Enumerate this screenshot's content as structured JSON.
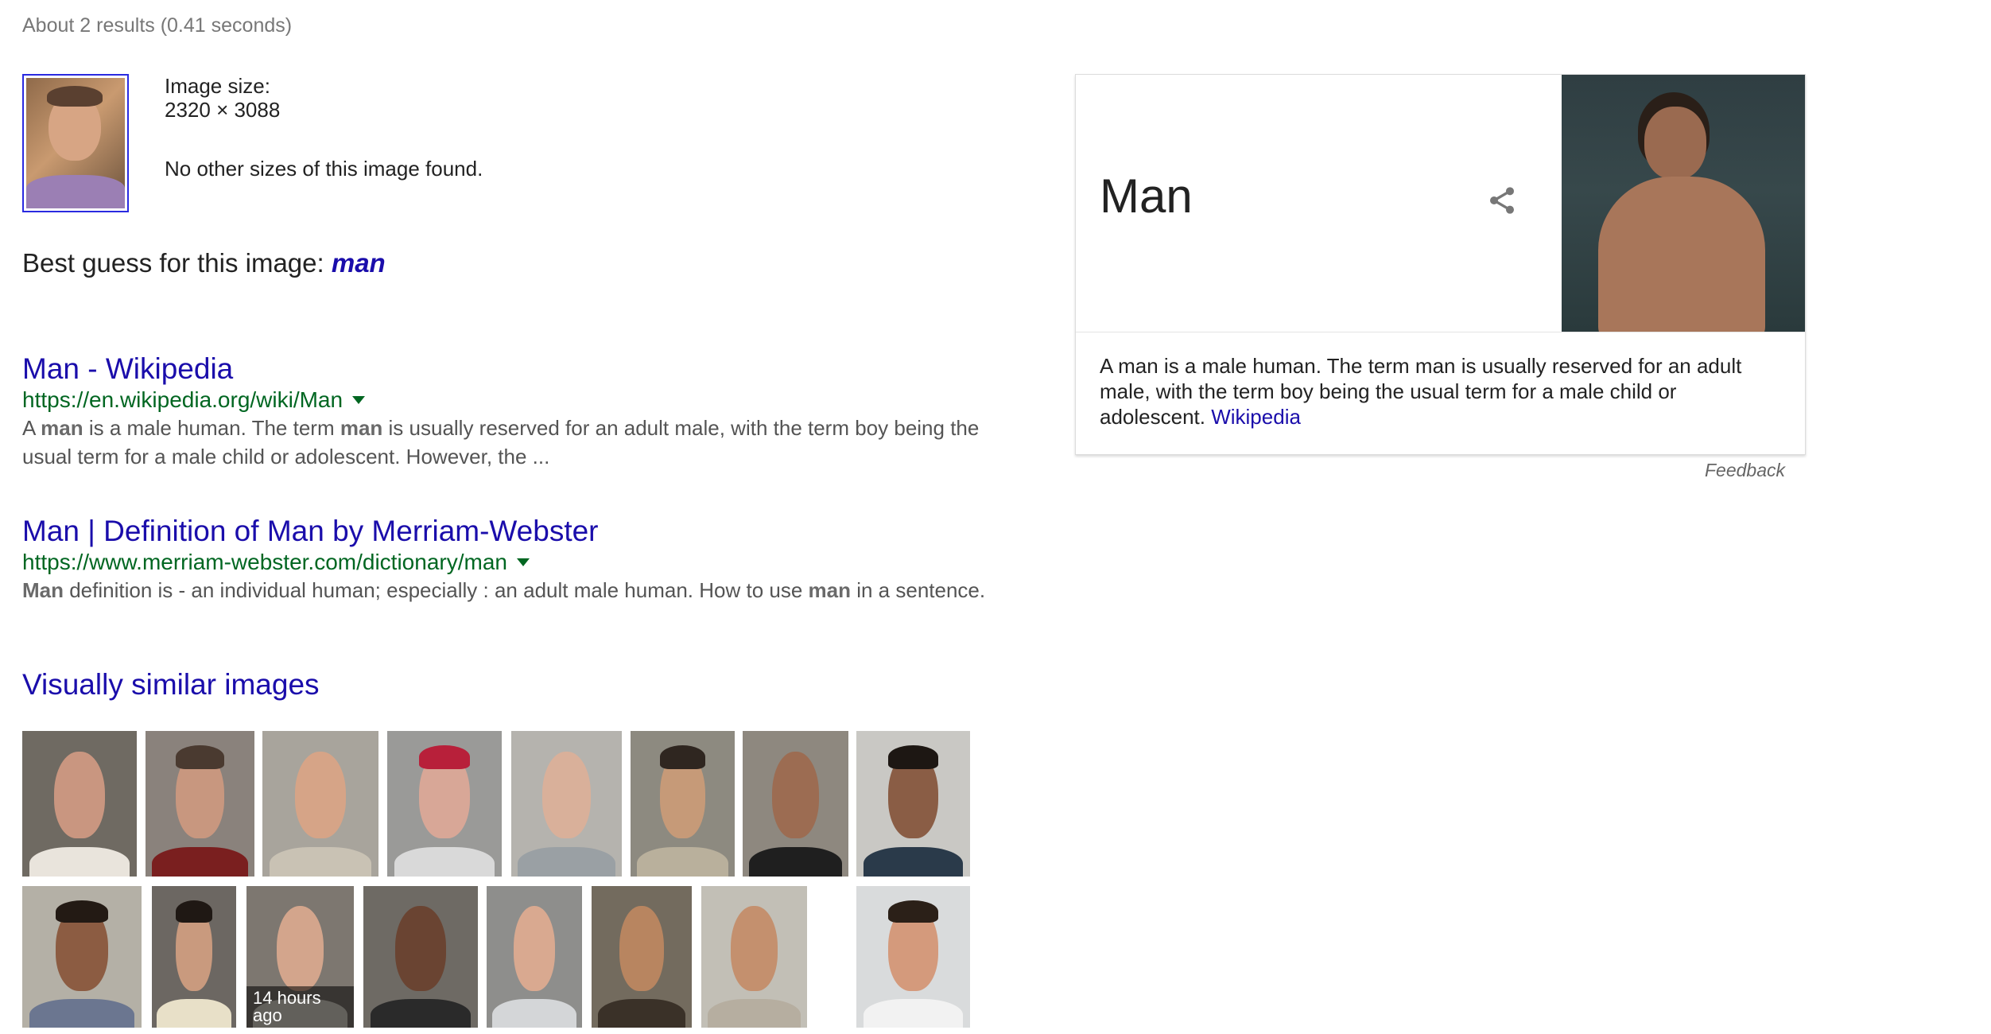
{
  "stats": "About 2 results (0.41 seconds)",
  "image_info": {
    "size_label": "Image size:",
    "size_value": "2320 × 3088",
    "other_sizes": "No other sizes of this image found."
  },
  "best_guess": {
    "label": "Best guess for this image:",
    "value": "man"
  },
  "results": [
    {
      "title": "Man - Wikipedia",
      "url": "https://en.wikipedia.org/wiki/Man",
      "snippet_parts": [
        "A ",
        "man",
        " is a male human. The term ",
        "man",
        " is usually reserved for an adult male, with the term boy being the usual term for a male child or adolescent. However, the ..."
      ]
    },
    {
      "title": "Man | Definition of Man by Merriam-Webster",
      "url": "https://www.merriam-webster.com/dictionary/man",
      "snippet_parts": [
        "Man",
        " definition is - an individual human; especially : an adult male human. How to use ",
        "man",
        " in a sentence."
      ]
    }
  ],
  "visually_similar": {
    "title": "Visually similar images",
    "time_badge": "14 hours ago"
  },
  "knowledge_panel": {
    "title": "Man",
    "description": "A man is a male human. The term man is usually reserved for an adult male, with the term boy being the usual term for a male child or adolescent. ",
    "source_link": "Wikipedia",
    "feedback": "Feedback",
    "share_icon": "share-icon"
  },
  "colors": {
    "link": "#1a0dab",
    "url_green": "#006621",
    "snippet_gray": "#545454"
  }
}
